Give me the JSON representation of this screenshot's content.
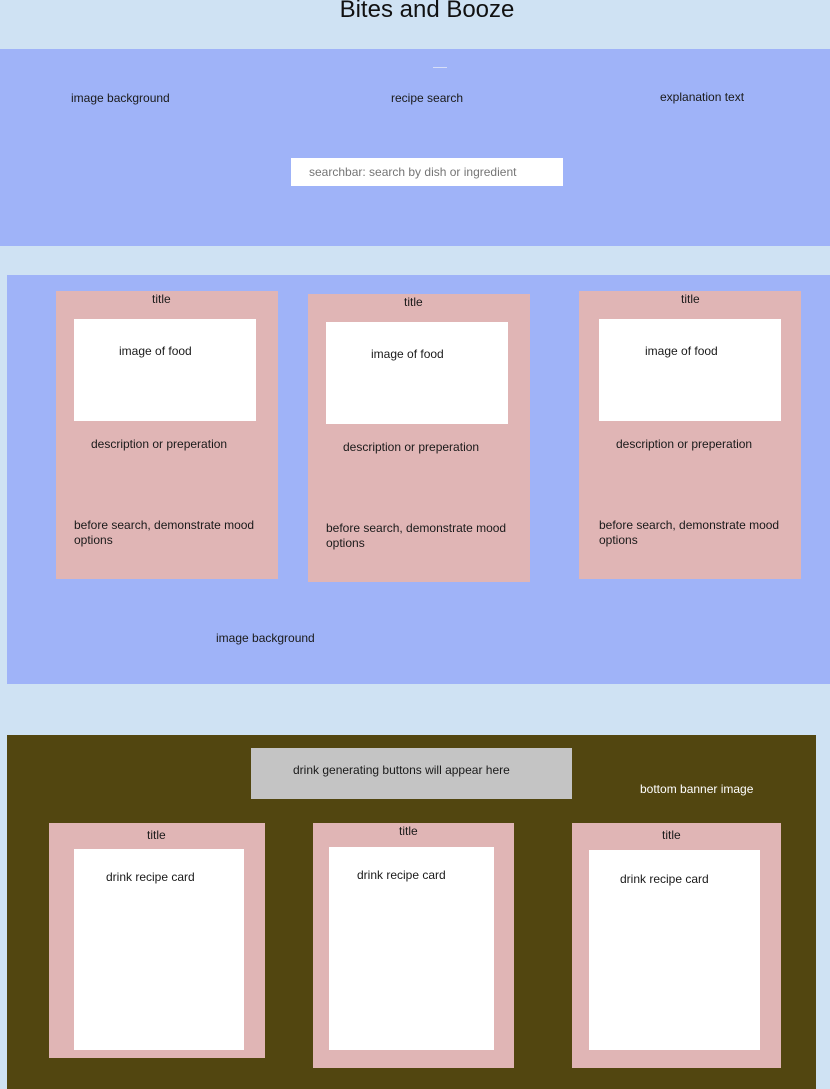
{
  "page": {
    "title": "Bites and Booze"
  },
  "hero": {
    "image_background_label": "image background",
    "recipe_search_label": "recipe search",
    "explanation_label": "explanation text",
    "searchbar_placeholder": "searchbar: search by dish or ingredient"
  },
  "food_section": {
    "background_label": "image background",
    "cards": [
      {
        "title": "title",
        "image_label": "image of food",
        "description": "description or preperation",
        "mood": "before search, demonstrate mood options"
      },
      {
        "title": "title",
        "image_label": "image of food",
        "description": "description or preperation",
        "mood": "before search, demonstrate mood options"
      },
      {
        "title": "title",
        "image_label": "image of food",
        "description": "description or preperation",
        "mood": "before search, demonstrate mood options"
      }
    ]
  },
  "drink_section": {
    "buttons_placeholder": "drink generating buttons will appear here",
    "banner_label": "bottom banner image",
    "cards": [
      {
        "title": "title",
        "card_label": "drink recipe card"
      },
      {
        "title": "title",
        "card_label": "drink recipe card"
      },
      {
        "title": "title",
        "card_label": "drink recipe card"
      }
    ]
  },
  "colors": {
    "page_background": "#cfe2f3",
    "hero_background": "#9fb3f8",
    "card_background": "#e0b5b5",
    "drink_section_background": "#524610",
    "drink_buttons_background": "#c4c4c4"
  }
}
